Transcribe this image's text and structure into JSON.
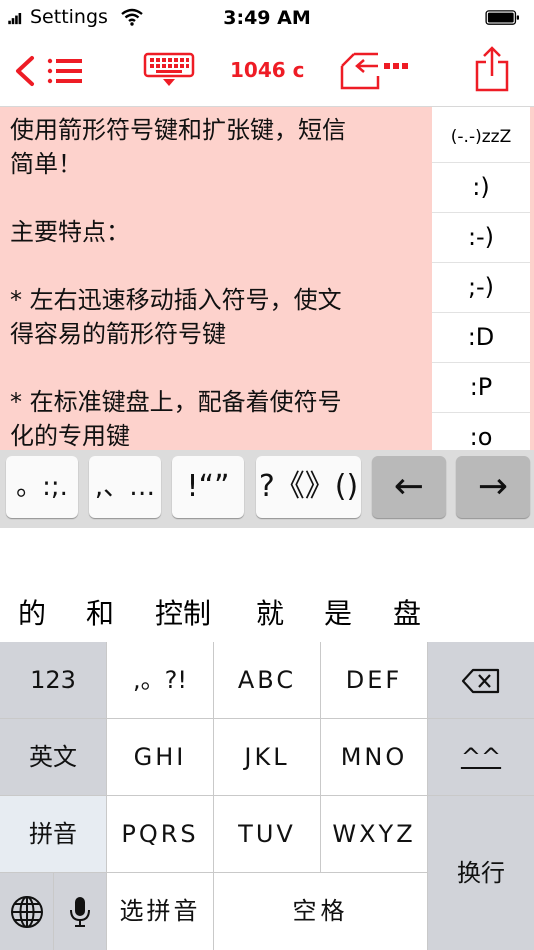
{
  "status": {
    "carrier": "Settings",
    "time": "3:49 AM"
  },
  "toolbar": {
    "char_count": "1046 c"
  },
  "editor": {
    "lines": [
      "使用箭形符号键和扩张键，短信",
      "简单！",
      "",
      "主要特点：",
      "",
      "* 左右迅速移动插入符号，使文",
      "得容易的箭形符号键",
      "",
      "* 在标准键盘上，配备着使符号",
      "化的专用键"
    ]
  },
  "emoticons": [
    "(-.-)zzZ",
    ":)",
    ":-)",
    ";-)",
    ":D",
    ":P",
    ":o"
  ],
  "symbol_keys": [
    "。:;.",
    ",、…",
    "!“”",
    "?《》()",
    "←",
    "→"
  ],
  "candidates": [
    "的",
    "和",
    "控制",
    "就",
    "是",
    "盘"
  ],
  "keyboard": {
    "k123": "123",
    "punct": ",。?!",
    "abc": "ABC",
    "def": "DEF",
    "english": "英文",
    "ghi": "GHI",
    "jkl": "JKL",
    "mno": "MNO",
    "face": "^^",
    "pinyin": "拼音",
    "pqrs": "PQRS",
    "tuv": "TUV",
    "wxyz": "WXYZ",
    "enter": "换行",
    "select_pinyin": "选拼音",
    "space": "空格"
  },
  "colors": {
    "accent": "#ee1c25",
    "editor_bg": "#fdd2cc",
    "key_gray": "#d1d3d9"
  }
}
